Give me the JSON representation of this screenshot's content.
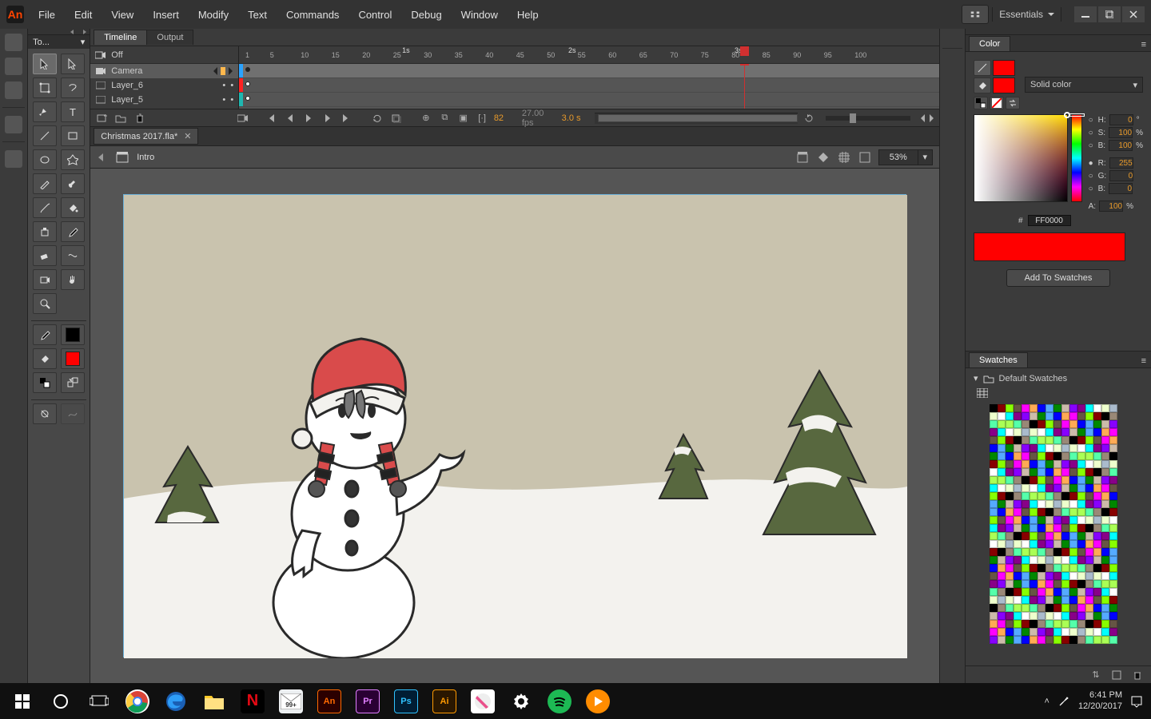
{
  "menubar": {
    "logo_text": "An",
    "items": [
      "File",
      "Edit",
      "View",
      "Insert",
      "Modify",
      "Text",
      "Commands",
      "Control",
      "Debug",
      "Window",
      "Help"
    ],
    "workspace": "Essentials"
  },
  "toolbox": {
    "title": "To...",
    "stroke": "#000000",
    "fill": "#ff0000"
  },
  "timeline": {
    "tabs": [
      "Timeline",
      "Output"
    ],
    "active_tab": 0,
    "camera_label": "Off",
    "layers": [
      {
        "name": "Camera",
        "color": "#2aa3ff",
        "selected": true,
        "type": "camera"
      },
      {
        "name": "Layer_6",
        "color": "#ff2222",
        "selected": false,
        "type": "layer"
      },
      {
        "name": "Layer_5",
        "color": "#1fb7b0",
        "selected": false,
        "type": "layer"
      }
    ],
    "seconds_markers": [
      "1s",
      "2s",
      "3s"
    ],
    "frame_ticks": [
      1,
      5,
      10,
      15,
      20,
      25,
      30,
      35,
      40,
      45,
      50,
      55,
      60,
      65,
      70,
      75,
      80,
      85,
      90,
      95,
      100
    ],
    "current_frame": "82",
    "fps": "27.00 fps",
    "elapsed": "3.0 s"
  },
  "document": {
    "tab_title": "Christmas 2017.fla*",
    "scene": "Intro",
    "zoom": "53%"
  },
  "color_panel": {
    "title": "Color",
    "mode": "Solid color",
    "H": "0",
    "S": "100",
    "B": "100",
    "R": "255",
    "G": "0",
    "Bv": "0",
    "A": "100",
    "hex": "FF0000",
    "add_btn": "Add To Swatches",
    "swatch": "#ff0000"
  },
  "swatches_panel": {
    "title": "Swatches",
    "set_name": "Default Swatches"
  },
  "taskbar": {
    "time": "6:41 PM",
    "date": "12/20/2017"
  }
}
